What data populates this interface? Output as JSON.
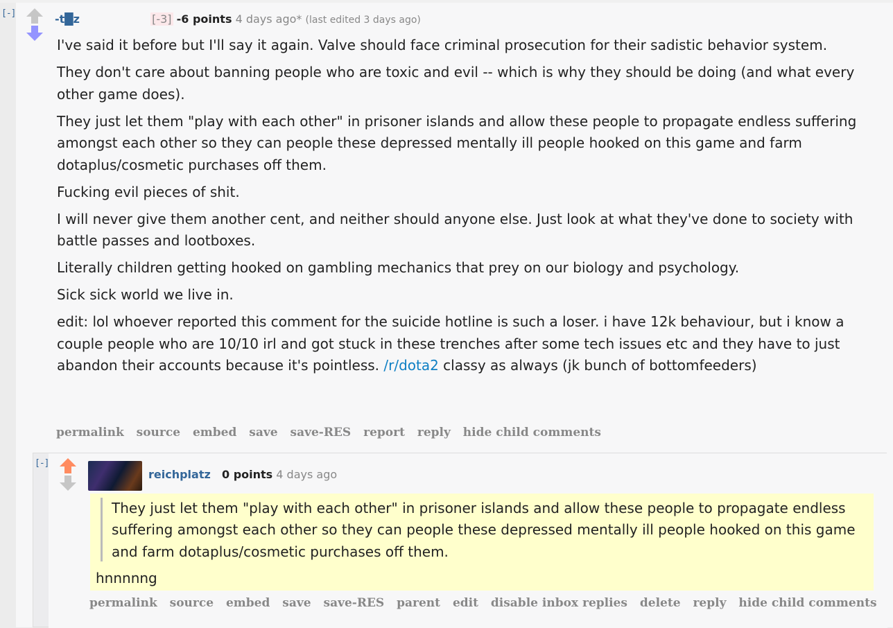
{
  "parent": {
    "collapse": "[-]",
    "author": "-t█z",
    "score_bracket": "[-3]",
    "points": "-6 points",
    "time": "4 days ago*",
    "edited": "(last edited 3 days ago)",
    "paragraphs": [
      "I've said it before but I'll say it again. Valve should face criminal prosecution for their sadistic behavior system.",
      "They don't care about banning people who are toxic and evil -- which is why they should be doing (and what every other game does).",
      "They just let them \"play with each other\" in prisoner islands and allow these people to propagate endless suffering amongst each other so they can people these depressed mentally ill people hooked on this game and farm dotaplus/cosmetic purchases off them.",
      "Fucking evil pieces of shit.",
      "I will never give them another cent, and neither should anyone else. Just look at what they've done to society with battle passes and lootboxes.",
      "Literally children getting hooked on gambling mechanics that prey on our biology and psychology.",
      "Sick sick world we live in."
    ],
    "edit_text_before": "edit: lol whoever reported this comment for the suicide hotline is such a loser. i have 12k behaviour, but i know a couple people who are 10/10 irl and got stuck in these trenches after some tech issues etc and they have to just abandon their accounts because it's pointless. ",
    "edit_link": "/r/dota2",
    "edit_text_after": " classy as always (jk bunch of bottomfeeders)",
    "buttons": {
      "permalink": "permalink",
      "source": "source",
      "embed": "embed",
      "save": "save",
      "save_res": "save-RES",
      "report": "report",
      "reply": "reply",
      "hide_child": "hide child comments"
    }
  },
  "child": {
    "collapse": "[-]",
    "author": "reichplatz",
    "points": "0 points",
    "time": "4 days ago",
    "quote": "They just let them \"play with each other\" in prisoner islands and allow these people to propagate endless suffering amongst each other so they can people these depressed mentally ill people hooked on this game and farm dotaplus/cosmetic purchases off them.",
    "reply": "hnnnnng",
    "buttons": {
      "permalink": "permalink",
      "source": "source",
      "embed": "embed",
      "save": "save",
      "save_res": "save-RES",
      "parent": "parent",
      "edit": "edit",
      "disable_inbox": "disable inbox replies",
      "delete": "delete",
      "reply": "reply",
      "hide_child": "hide child comments"
    }
  },
  "colors": {
    "upvote_gray": "#c6c6c6",
    "downvote_active": "#9494ff",
    "upvote_active": "#ff8b60",
    "downvote_gray": "#c6c6c6",
    "link": "#0e7fc4",
    "author": "#336699",
    "quote_bg": "#ffffcc"
  }
}
